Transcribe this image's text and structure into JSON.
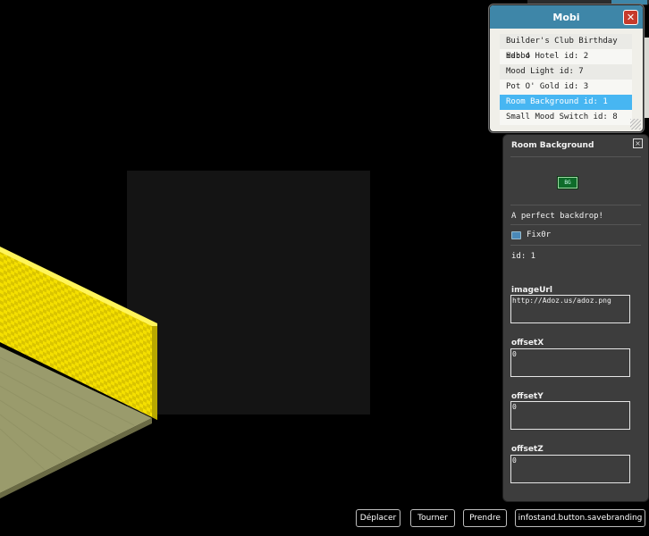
{
  "mobi": {
    "title": "Mobi",
    "close_icon": "close-icon",
    "items": [
      {
        "label": "Builder's Club Birthday id: 4",
        "selected": false
      },
      {
        "label": "Habbo Hotel id: 2",
        "selected": false
      },
      {
        "label": "Mood Light id: 7",
        "selected": false
      },
      {
        "label": "Pot O' Gold id: 3",
        "selected": false
      },
      {
        "label": "Room Background id: 1",
        "selected": true
      },
      {
        "label": "Small Mood Switch id: 8",
        "selected": false
      }
    ]
  },
  "info": {
    "title": "Room Background",
    "description": "A perfect backdrop!",
    "owner": "Fix0r",
    "id_text": "id: 1",
    "fields": [
      {
        "label": "imageUrl",
        "value": "http://Adoz.us/adoz.png"
      },
      {
        "label": "offsetX",
        "value": "0"
      },
      {
        "label": "offsetY",
        "value": "0"
      },
      {
        "label": "offsetZ",
        "value": "0"
      }
    ]
  },
  "buttons": {
    "move": "Déplacer",
    "rotate": "Tourner",
    "pickup": "Prendre",
    "savebranding": "infostand.button.savebranding"
  },
  "colors": {
    "wall": "#f5e000",
    "floor": "#9a9b6c",
    "panel": "#3d3d3d",
    "mobi_header": "#3e86a8",
    "selection": "#47b6f2"
  }
}
